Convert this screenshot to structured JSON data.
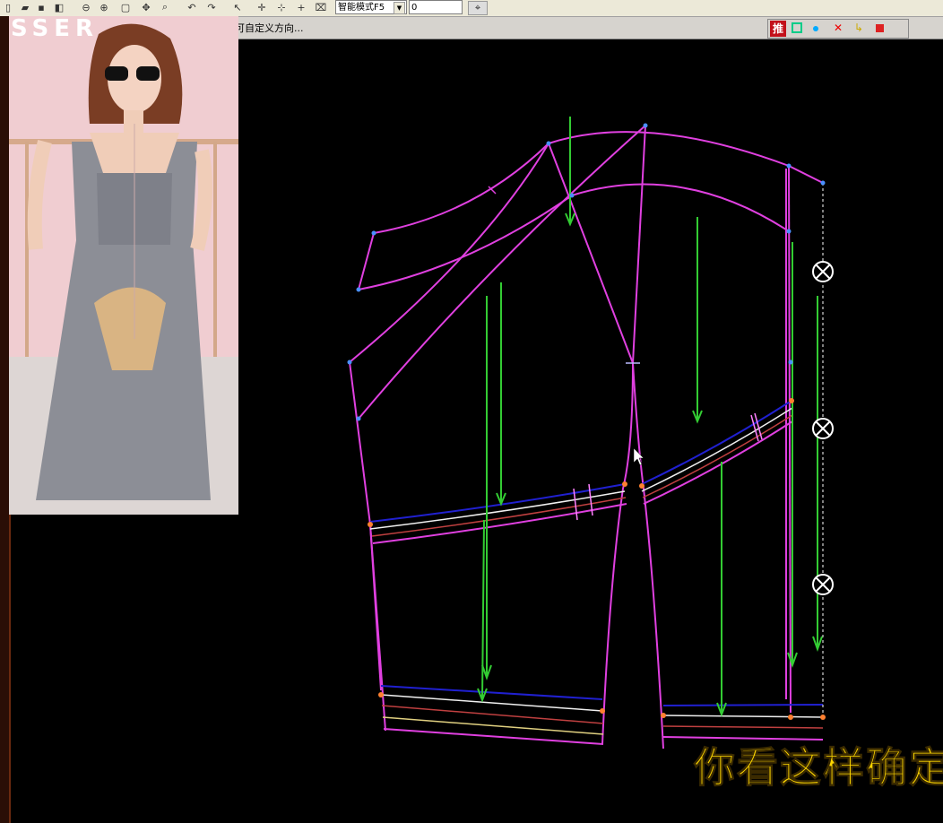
{
  "toolbar": {
    "mode_select": "智能模式F5",
    "number_input": "0",
    "icons": [
      "new-file-icon",
      "open-folder-icon",
      "save-icon",
      "zoom-out-icon",
      "zoom-in-icon",
      "zoom-fit-icon",
      "pan-icon",
      "zoom-window-icon",
      "undo-icon",
      "redo-icon",
      "select-arrow-icon",
      "move-point-icon",
      "align-point-icon",
      "add-point-icon",
      "delete-point-icon"
    ]
  },
  "status": {
    "hint": "可自定义方向..."
  },
  "right_tools": {
    "push_label": "推",
    "icons": [
      "rect-icon",
      "dot-icon",
      "cross-icon",
      "corner-icon",
      "stop-icon"
    ]
  },
  "photo": {
    "watermark": "SSER"
  },
  "subtitle": "你看这样确定",
  "colors": {
    "canvas": "#000000",
    "pattern_line": "#e040e0",
    "guide_arrow": "#33cc33",
    "seam_blue": "#2020d0",
    "subtitle": "#ffd800",
    "point": "#4a90ff"
  }
}
